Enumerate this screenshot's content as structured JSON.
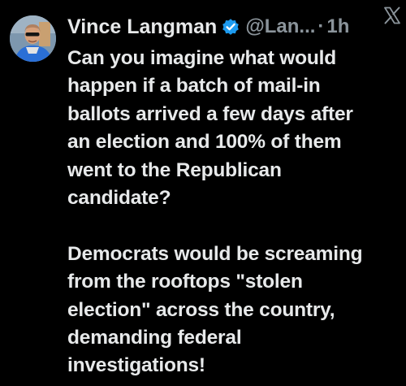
{
  "post": {
    "author": {
      "display_name": "Vince Langman",
      "handle": "@Lan...",
      "verified_icon": "verified-badge-icon",
      "avatar_icon": "avatar"
    },
    "separator": "·",
    "timestamp": "1h",
    "platform_icon": "x-logo-icon",
    "text": "Can you imagine what would\nhappen if a batch of mail-in\nballots arrived a few days after\nan election and 100% of them\nwent to the Republican\ncandidate?\n\nDemocrats would be screaming\nfrom the rooftops \"stolen\nelection\" across the country,\ndemanding federal\ninvestigations!"
  },
  "colors": {
    "background": "#000000",
    "primary_text": "#e7e9ea",
    "secondary_text": "#8b949b",
    "verified_blue": "#1d9bf0"
  }
}
